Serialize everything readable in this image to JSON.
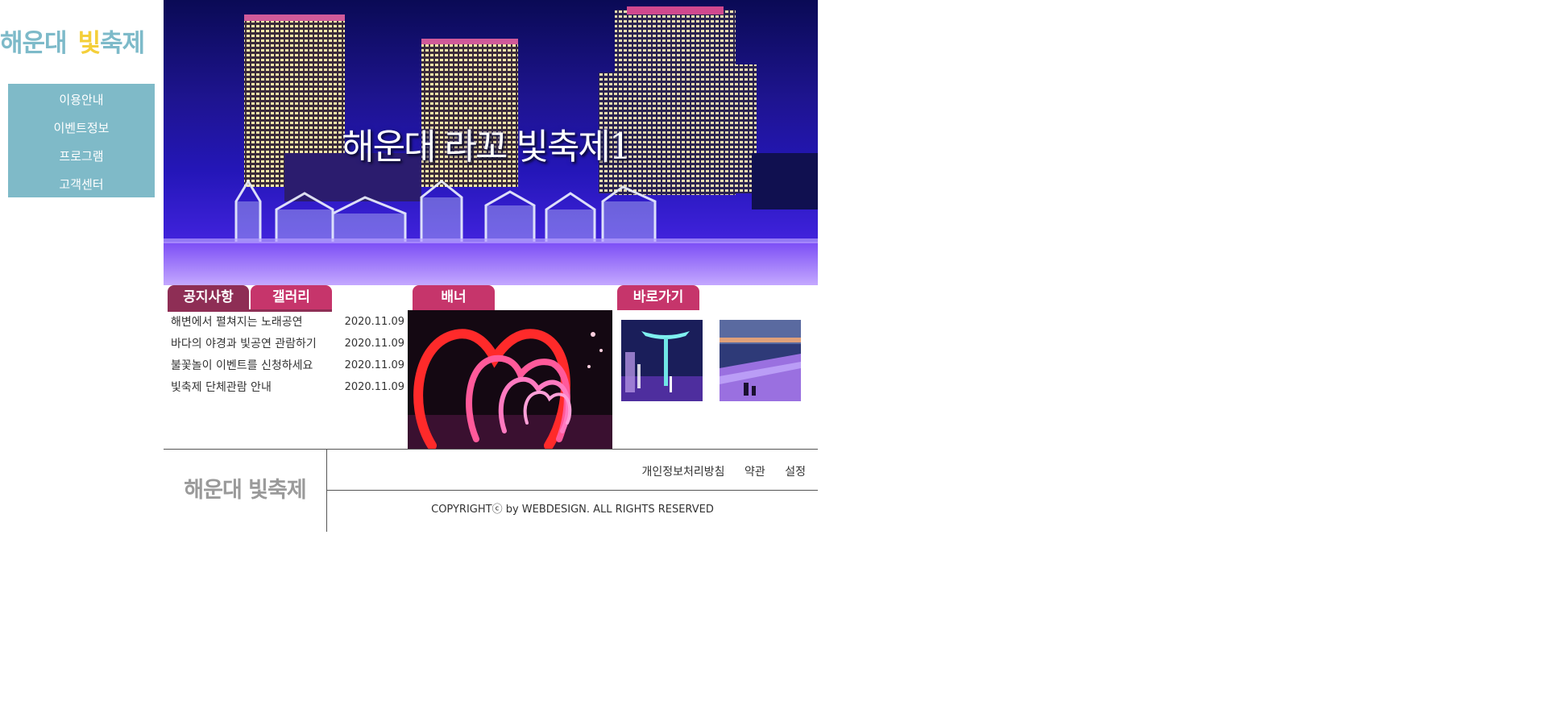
{
  "logo": {
    "part1": "해운대",
    "part2": "빛",
    "part3": "축제"
  },
  "nav": {
    "items": [
      {
        "label": "이용안내"
      },
      {
        "label": "이벤트정보"
      },
      {
        "label": "프로그램"
      },
      {
        "label": "고객센터"
      }
    ]
  },
  "hero": {
    "title": "해운대 라꼬 빛축제1"
  },
  "tabs": {
    "notice": "공지사항",
    "gallery": "갤러리",
    "banner": "배너",
    "shortcut": "바로가기"
  },
  "notices": [
    {
      "title": "해변에서 펼쳐지는 노래공연",
      "date": "2020.11.09"
    },
    {
      "title": "바다의 야경과 빛공연 관람하기",
      "date": "2020.11.09"
    },
    {
      "title": "불꽃놀이 이벤트를 신청하세요",
      "date": "2020.11.09"
    },
    {
      "title": "빛축제 단체관람 안내",
      "date": "2020.11.09"
    }
  ],
  "footer": {
    "logo": "해운대 빛축제",
    "links": [
      "개인정보처리방침",
      "약관",
      "설정"
    ],
    "copyright": "COPYRIGHTⓒ by WEBDESIGN. ALL RIGHTS RESERVED"
  },
  "colors": {
    "nav_bg": "#7fbac8",
    "logo_teal": "#7dbac9",
    "logo_yellow": "#f4cf3a",
    "tab_pink": "#c6356b",
    "tab_active": "#8e2e55"
  }
}
